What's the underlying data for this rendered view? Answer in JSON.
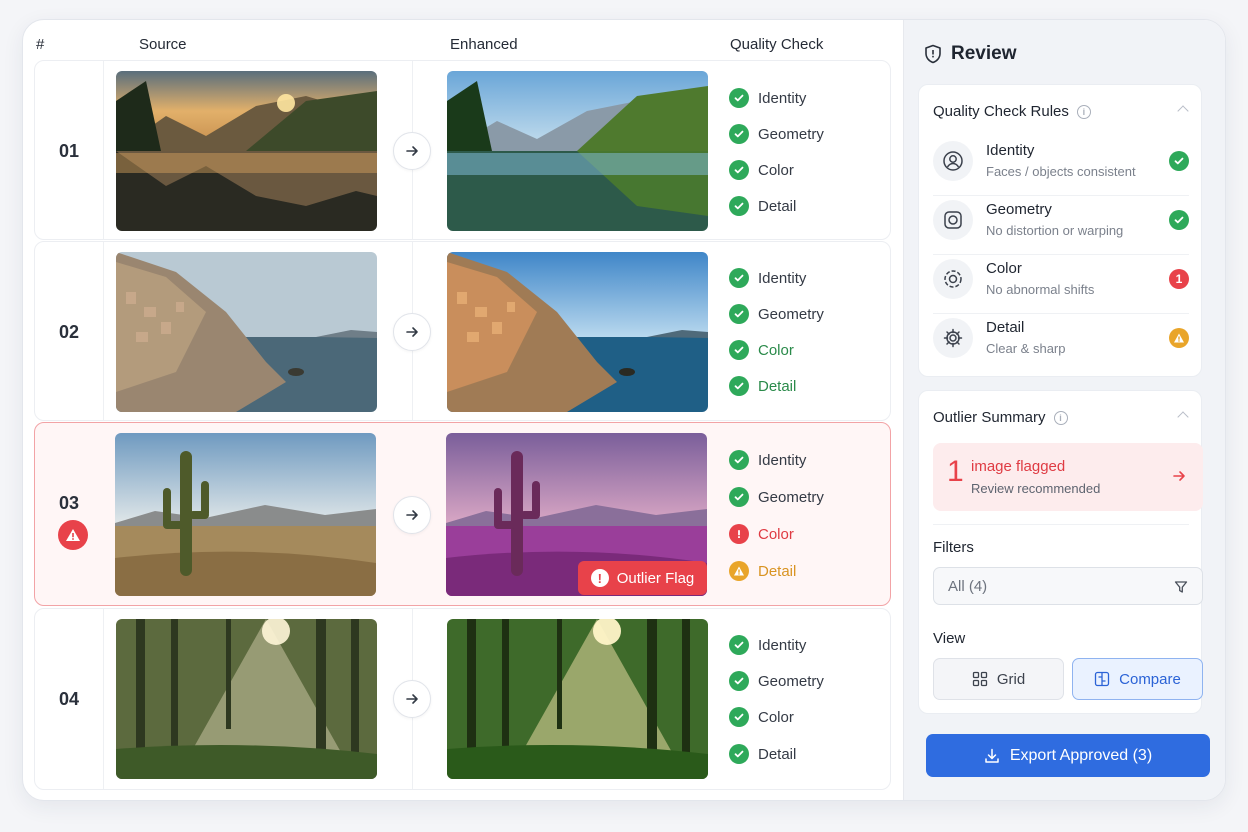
{
  "table": {
    "headers": {
      "num": "#",
      "source": "Source",
      "enhanced": "Enhanced",
      "quality": "Quality Check"
    },
    "rows": [
      {
        "num": "01",
        "checks": [
          {
            "label": "Identity",
            "status": "ok"
          },
          {
            "label": "Geometry",
            "status": "ok"
          },
          {
            "label": "Color",
            "status": "ok"
          },
          {
            "label": "Detail",
            "status": "ok"
          }
        ]
      },
      {
        "num": "02",
        "checks": [
          {
            "label": "Identity",
            "status": "ok"
          },
          {
            "label": "Geometry",
            "status": "ok"
          },
          {
            "label": "Color",
            "status": "ok"
          },
          {
            "label": "Detail",
            "status": "ok"
          }
        ]
      },
      {
        "num": "03",
        "flag_label": "Outlier Flag",
        "checks": [
          {
            "label": "Identity",
            "status": "ok"
          },
          {
            "label": "Geometry",
            "status": "ok"
          },
          {
            "label": "Color",
            "status": "error"
          },
          {
            "label": "Detail",
            "status": "warning"
          }
        ]
      },
      {
        "num": "04",
        "checks": [
          {
            "label": "Identity",
            "status": "ok"
          },
          {
            "label": "Geometry",
            "status": "ok"
          },
          {
            "label": "Color",
            "status": "ok"
          },
          {
            "label": "Detail",
            "status": "ok"
          }
        ]
      }
    ]
  },
  "sidebar": {
    "title": "Review",
    "rules_title": "Quality Check Rules",
    "rules": [
      {
        "name": "Identity",
        "desc": "Faces / objects consistent",
        "status": "ok",
        "icon": "face-icon"
      },
      {
        "name": "Geometry",
        "desc": "No distortion or warping",
        "status": "ok",
        "icon": "camera-icon"
      },
      {
        "name": "Color",
        "desc": "No abnormal shifts",
        "status": "error",
        "count": "1",
        "icon": "palette-icon"
      },
      {
        "name": "Detail",
        "desc": "Clear & sharp",
        "status": "warning",
        "icon": "gear-icon"
      }
    ],
    "outlier_title": "Outlier Summary",
    "outlier_count": "1",
    "outlier_text": "image flagged",
    "outlier_sub": "Review recommended",
    "filters_label": "Filters",
    "filter_value": "All (4)",
    "view_label": "View",
    "view_grid": "Grid",
    "view_compare": "Compare",
    "export_label": "Export Approved (3)"
  },
  "colors": {
    "ok": "#2ea95a",
    "error": "#e8424a",
    "warning": "#e9a52a",
    "accent": "#2f6ce0"
  }
}
